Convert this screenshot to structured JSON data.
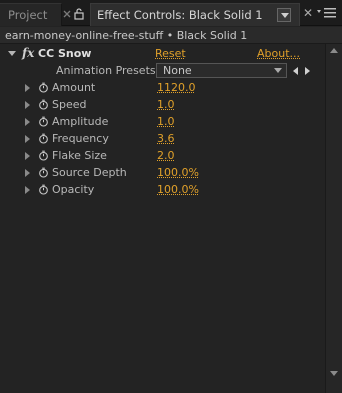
{
  "tabs": {
    "project_label": "Project",
    "active_label": "Effect Controls: Black Solid 1"
  },
  "breadcrumb": "earn-money-online-free-stuff • Black Solid 1",
  "effect": {
    "fx_label": "fx",
    "name": "CC Snow",
    "reset_label": "Reset",
    "about_label": "About...",
    "presets_label": "Animation Presets:",
    "presets_value": "None"
  },
  "properties": [
    {
      "label": "Amount",
      "value": "1120.0"
    },
    {
      "label": "Speed",
      "value": "1.0"
    },
    {
      "label": "Amplitude",
      "value": "1.0"
    },
    {
      "label": "Frequency",
      "value": "3.6"
    },
    {
      "label": "Flake Size",
      "value": "2.0"
    },
    {
      "label": "Source Depth",
      "value": "100.0%"
    },
    {
      "label": "Opacity",
      "value": "100.0%"
    }
  ],
  "colors": {
    "accent": "#e1a12a",
    "panel_bg": "#232323"
  }
}
